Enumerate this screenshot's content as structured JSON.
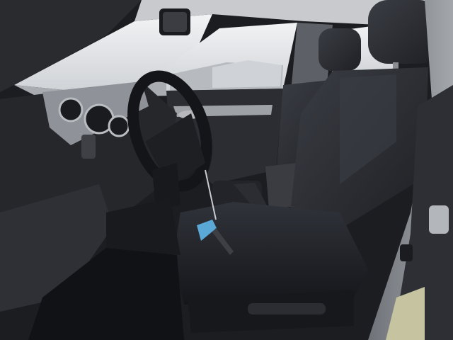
{
  "scene": {
    "subject": "car-interior-front-seats",
    "colors": {
      "sky": "#e9ecef",
      "outside_ground": "#b9bcc0",
      "cabin_dark": "#1c1d21",
      "upholstery": "#2a2c31",
      "upholstery_light": "#3a3d44",
      "dash_trim": "#9a9da3",
      "door_frame": "#8e9096",
      "tag_blue": "#5aa8d6",
      "floor_mat": "#111215"
    }
  }
}
